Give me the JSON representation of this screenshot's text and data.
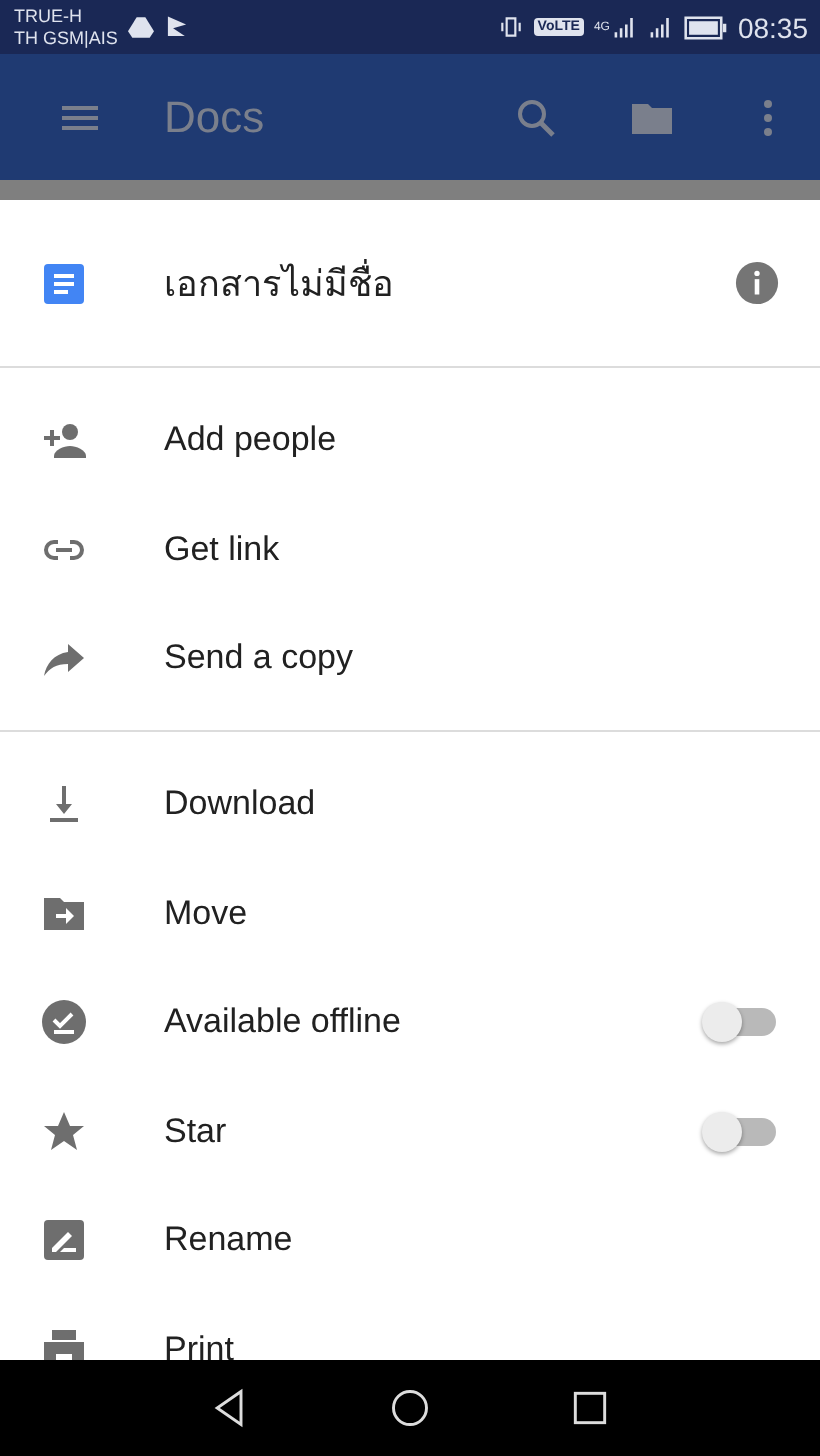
{
  "status_bar": {
    "carrier_lines": [
      "TRUE-H",
      "TH GSM|AIS"
    ],
    "volte": "VoLTE",
    "network": "4G",
    "time": "08:35"
  },
  "app_bar": {
    "title": "Docs"
  },
  "sheet": {
    "file_title": "เอกสารไม่มีชื่อ",
    "sections": [
      {
        "items": [
          {
            "kind": "action",
            "label": "Add people"
          },
          {
            "kind": "action",
            "label": "Get link"
          },
          {
            "kind": "action",
            "label": "Send a copy"
          }
        ]
      },
      {
        "items": [
          {
            "kind": "action",
            "label": "Download"
          },
          {
            "kind": "action",
            "label": "Move"
          },
          {
            "kind": "toggle",
            "label": "Available offline",
            "on": false
          },
          {
            "kind": "toggle",
            "label": "Star",
            "on": false
          },
          {
            "kind": "action",
            "label": "Rename"
          },
          {
            "kind": "action",
            "label": "Print"
          }
        ]
      }
    ]
  }
}
